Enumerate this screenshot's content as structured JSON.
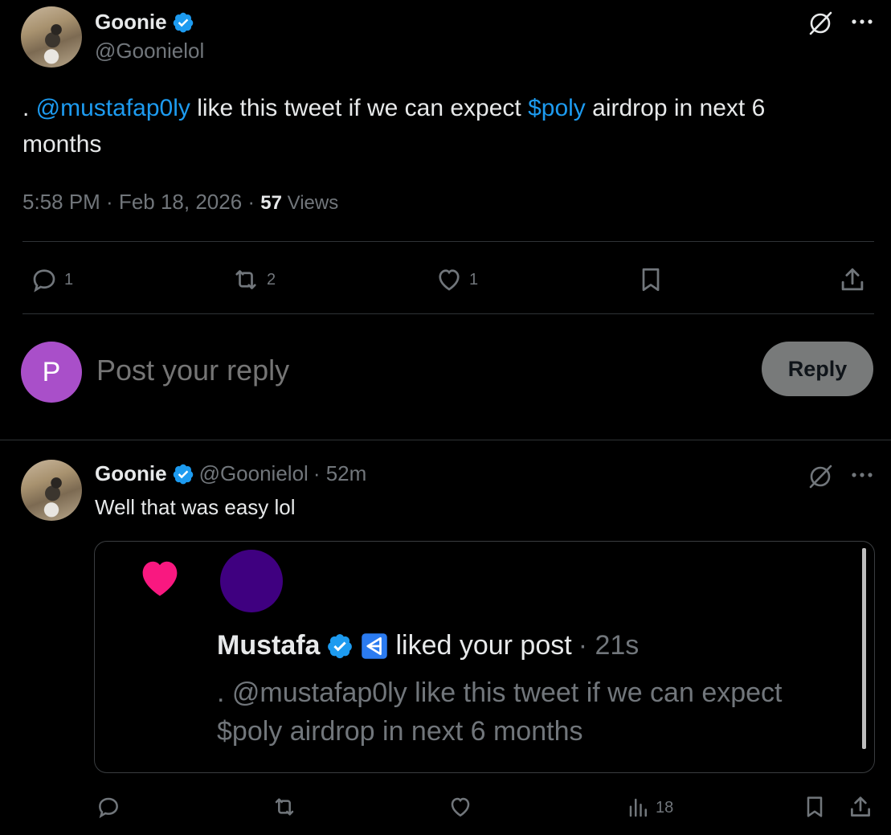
{
  "main_post": {
    "author_name": "Goonie",
    "author_handle": "@Goonielol",
    "text_prefix": ". ",
    "mention": "@mustafap0ly",
    "text_mid": " like this tweet if we can expect ",
    "cashtag": "$poly",
    "text_suffix": " airdrop in next 6",
    "text_line2": "months",
    "timestamp": "5:58 PM · Feb 18, 2026 · ",
    "views_count": "57",
    "views_label": " Views",
    "replies": "1",
    "reposts": "2",
    "likes": "1"
  },
  "composer": {
    "avatar_letter": "P",
    "avatar_color": "#a94fc9",
    "placeholder": "Post your reply",
    "reply_label": "Reply"
  },
  "reply_post": {
    "author_name": "Goonie",
    "author_handle": "@Goonielol",
    "age": "· 52m",
    "text": "Well that was easy lol",
    "views": "18",
    "notification": {
      "liker_name": "Mustafa",
      "action": "liked your post",
      "age": "· 21s",
      "line1": ". @mustafap0ly like this tweet if we can expect",
      "line2": "$poly airdrop in next 6 months",
      "avatar_color": "#3f0080",
      "heart_color": "#f91880"
    }
  },
  "colors": {
    "accent": "#1d9bf0",
    "muted": "#71767b",
    "background": "#000000"
  }
}
